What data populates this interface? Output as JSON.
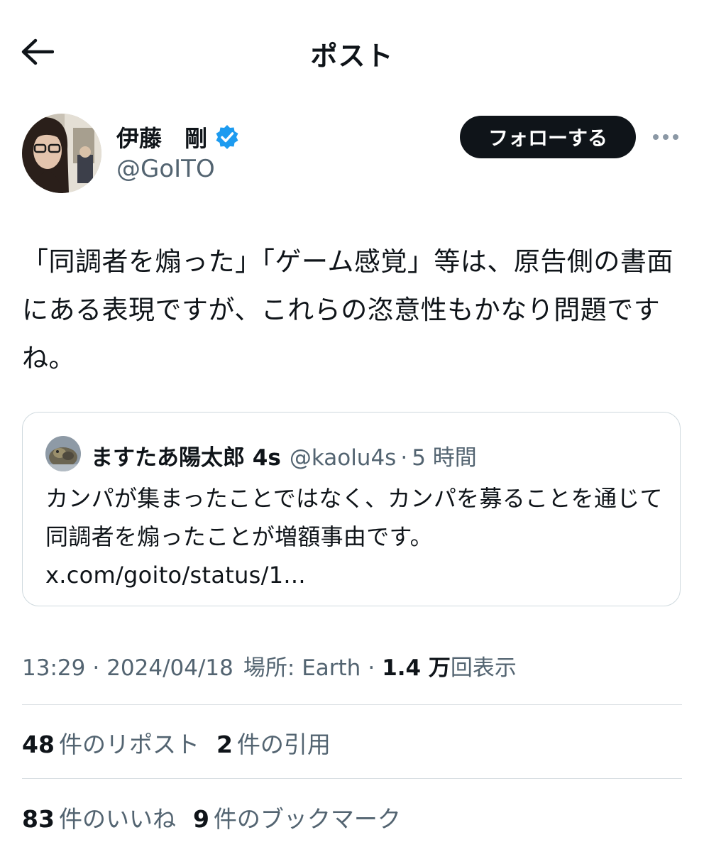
{
  "header": {
    "title": "ポスト",
    "back_icon": "arrow-left-icon"
  },
  "author": {
    "name": "伊藤　剛",
    "handle": "@GoITO",
    "verified": true,
    "follow_label": "フォローする",
    "more_icon": "more-horizontal-icon"
  },
  "post": {
    "text": "「同調者を煽った」「ゲーム感覚」等は、原告側の書面にある表現ですが、これらの恣意性もかなり問題ですね。"
  },
  "quote": {
    "name": "ますたあ陽太郎 4s",
    "handle": "@kaolu4s",
    "separator": "·",
    "time": "5 時間",
    "text": "カンパが集まったことではなく、カンパを募ることを通じて同調者を煽ったことが増額事由です。 x.com/goito/status/1..."
  },
  "meta": {
    "time": "13:29",
    "date": "2024/04/18",
    "location": "場所: Earth",
    "separator": "·",
    "views_count": "1.4 万",
    "views_label": "回表示"
  },
  "stats": {
    "reposts_count": "48",
    "reposts_label": "件のリポスト",
    "quotes_count": "2",
    "quotes_label": "件の引用",
    "likes_count": "83",
    "likes_label": "件のいいね",
    "bookmarks_count": "9",
    "bookmarks_label": "件のブックマーク"
  },
  "colors": {
    "text": "#0f1419",
    "secondary": "#536471",
    "verified": "#1d9bf0",
    "border": "#cfd9de"
  }
}
